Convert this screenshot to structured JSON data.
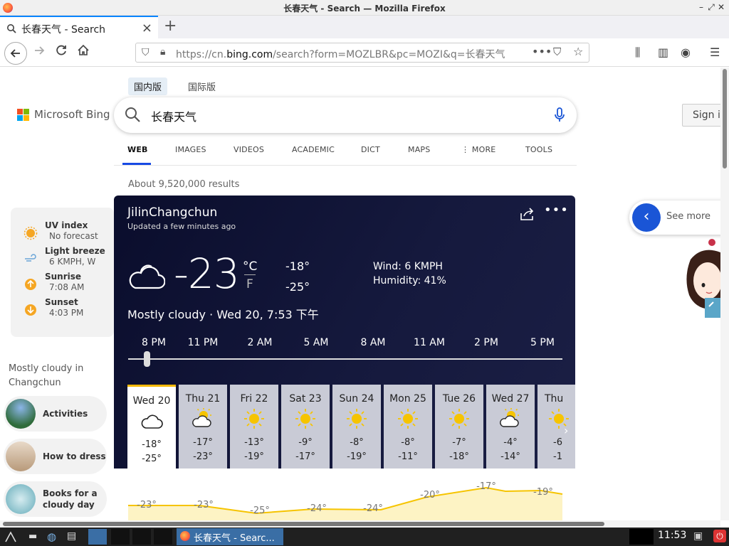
{
  "window": {
    "title": "长春天气 - Search — Mozilla Firefox"
  },
  "tab": {
    "label": "长春天气 - Search",
    "close": "×"
  },
  "newtab": "+",
  "url": {
    "prefix": "https://cn.",
    "domain": "bing.com",
    "rest": "/search?form=MOZLBR&pc=MOZI&q=长春天气"
  },
  "bing": {
    "region_tabs": [
      "国内版",
      "国际版"
    ],
    "logo_text": "Microsoft Bing",
    "query": "长春天气",
    "signin": "Sign in",
    "scopes": [
      "WEB",
      "IMAGES",
      "VIDEOS",
      "ACADEMIC",
      "DICT",
      "MAPS",
      "MORE",
      "TOOLS"
    ],
    "results_count": "About 9,520,000 results"
  },
  "weather": {
    "location": "JilinChangchun",
    "updated": "Updated a few minutes ago",
    "temp": "-23",
    "unit_c": "°C",
    "unit_f": "F",
    "high": "-18°",
    "low": "-25°",
    "wind": "Wind: 6 KMPH",
    "humidity": "Humidity: 41%",
    "condition": "Mostly cloudy · Wed 20, 7:53 下午",
    "hours": [
      "8 PM",
      "11 PM",
      "2 AM",
      "5 AM",
      "8 AM",
      "11 AM",
      "2 PM",
      "5 PM"
    ],
    "days": [
      {
        "label": "Wed 20",
        "icon": "cloudy-icon",
        "hi": "-18°",
        "lo": "-25°"
      },
      {
        "label": "Thu 21",
        "icon": "partly-sunny-icon",
        "hi": "-17°",
        "lo": "-23°"
      },
      {
        "label": "Fri 22",
        "icon": "sunny-icon",
        "hi": "-13°",
        "lo": "-19°"
      },
      {
        "label": "Sat 23",
        "icon": "sunny-icon",
        "hi": "-9°",
        "lo": "-17°"
      },
      {
        "label": "Sun 24",
        "icon": "sunny-icon",
        "hi": "-8°",
        "lo": "-19°"
      },
      {
        "label": "Mon 25",
        "icon": "sunny-icon",
        "hi": "-8°",
        "lo": "-11°"
      },
      {
        "label": "Tue 26",
        "icon": "sunny-icon",
        "hi": "-7°",
        "lo": "-18°"
      },
      {
        "label": "Wed 27",
        "icon": "partly-sunny-icon",
        "hi": "-4°",
        "lo": "-14°"
      },
      {
        "label": "Thu",
        "icon": "sunny-icon",
        "hi": "-6",
        "lo": "-1"
      }
    ],
    "hourly_temps": [
      "-23°",
      "-23°",
      "-25°",
      "-24°",
      "-24°",
      "-20°",
      "-17°",
      "-19°"
    ]
  },
  "side": {
    "rows": [
      {
        "title": "UV index",
        "value": "No forecast",
        "icon": "uv-icon"
      },
      {
        "title": "Light breeze",
        "value": "6 KMPH, W",
        "icon": "wind-icon"
      },
      {
        "title": "Sunrise",
        "value": "7:08 AM",
        "icon": "sunrise-icon"
      },
      {
        "title": "Sunset",
        "value": "4:03 PM",
        "icon": "sunset-icon"
      }
    ],
    "heading": "Mostly cloudy in Changchun",
    "pills": [
      "Activities",
      "How to dress",
      "Books for a cloudy day"
    ]
  },
  "seemore": "See more",
  "clock": "11:53",
  "taskbar_window": "长春天气 - Searc..."
}
